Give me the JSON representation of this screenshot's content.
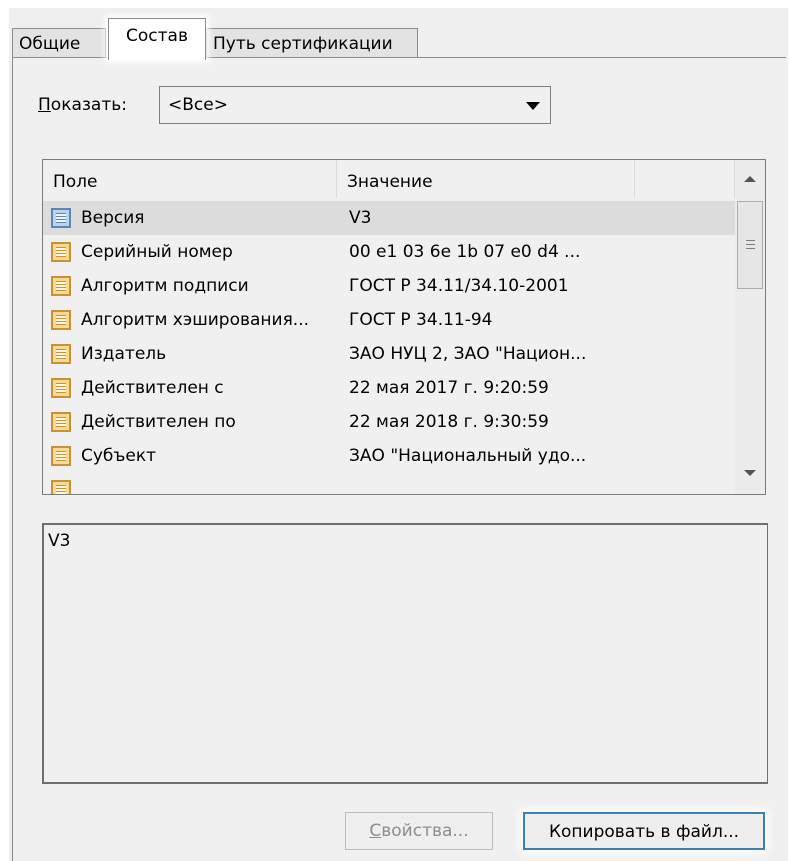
{
  "tabs": [
    {
      "label": "Общие"
    },
    {
      "label": "Состав"
    },
    {
      "label": "Путь сертификации"
    }
  ],
  "show": {
    "label_accel": "П",
    "label_rest": "оказать:",
    "value": "<Все>"
  },
  "list": {
    "columns": [
      "Поле",
      "Значение"
    ],
    "rows": [
      {
        "field": "Версия",
        "value": "V3"
      },
      {
        "field": "Серийный номер",
        "value": "00 e1 03 6e 1b 07 e0 d4 ..."
      },
      {
        "field": "Алгоритм подписи",
        "value": "ГОСТ Р 34.11/34.10-2001"
      },
      {
        "field": "Алгоритм хэширования...",
        "value": "ГОСТ Р 34.11-94"
      },
      {
        "field": "Издатель",
        "value": "ЗАО НУЦ 2, ЗАО \"Национ..."
      },
      {
        "field": "Действителен с",
        "value": "22 мая 2017 г. 9:20:59"
      },
      {
        "field": "Действителен по",
        "value": "22 мая 2018 г. 9:30:59"
      },
      {
        "field": "Субъект",
        "value": "ЗАО \"Национальный удо..."
      }
    ]
  },
  "detail_text": "V3",
  "buttons": {
    "properties_accel": "С",
    "properties_rest": "войства...",
    "copy": "Копировать в файл..."
  },
  "icons": {
    "field_icon": "certificate-field-icon",
    "selected_field_icon": "certificate-field-icon-selected"
  }
}
